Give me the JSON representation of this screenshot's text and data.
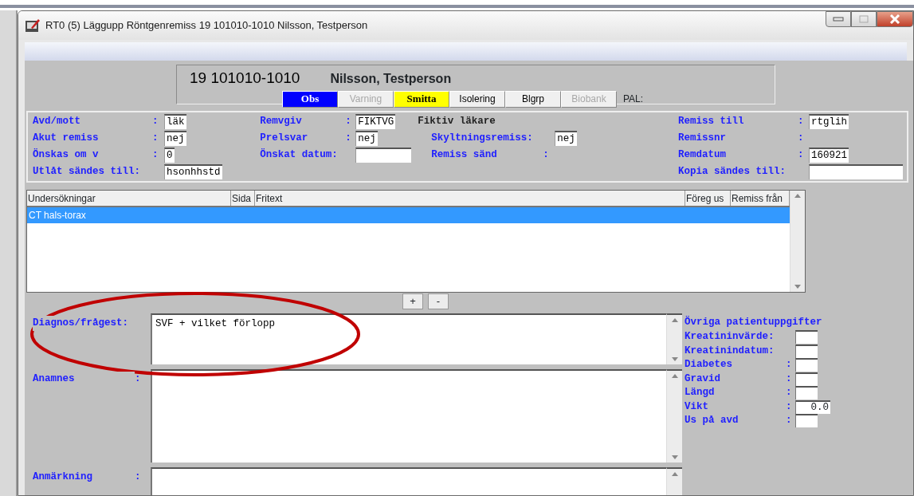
{
  "window": {
    "title": "RT0 (5) Läggupp Röntgenremiss 19 101010-1010 Nilsson, Testperson"
  },
  "patient": {
    "id": "19 101010-1010",
    "name": "Nilsson, Testperson",
    "pal_label": "PAL:",
    "flags": [
      {
        "label": "Obs",
        "color": "#0000ff",
        "emphasized": true,
        "disabled": false
      },
      {
        "label": "Varning",
        "color": "#f0f0f0",
        "emphasized": false,
        "disabled": true
      },
      {
        "label": "Smitta",
        "color": "#ffff00",
        "emphasized": true,
        "disabled": false
      },
      {
        "label": "Isolering",
        "color": "#f0f0f0",
        "emphasized": false,
        "disabled": false
      },
      {
        "label": "Blgrp",
        "color": "#f0f0f0",
        "emphasized": false,
        "disabled": false
      },
      {
        "label": "Biobank",
        "color": "#f0f0f0",
        "emphasized": false,
        "disabled": true
      }
    ]
  },
  "form": {
    "columns": [
      {
        "fields": [
          {
            "kind": "input",
            "label": "Avd/mott",
            "colon": ":",
            "value": "läk"
          },
          {
            "kind": "input",
            "label": "Akut remiss",
            "colon": ":",
            "value": "nej"
          },
          {
            "kind": "input",
            "label": "Önskas om v",
            "colon": ":",
            "value": "0"
          },
          {
            "kind": "input",
            "label": "Utlåt sändes till:",
            "value": "hsonhhstd"
          }
        ]
      },
      {
        "fields": [
          {
            "kind": "input",
            "label": "Remvgiv",
            "colon": ":",
            "value": "FIKTVG"
          },
          {
            "kind": "input",
            "label": "Prelsvar",
            "colon": ":",
            "value": "nej"
          },
          {
            "kind": "input",
            "label": "Önskat datum:"
          }
        ]
      },
      {
        "fields": [
          {
            "kind": "note",
            "label": "Fiktiv läkare"
          },
          {
            "kind": "input",
            "label": "Skyltningsremiss:",
            "value": "nej"
          },
          {
            "kind": "label",
            "label": "Remiss sänd",
            "colon": ":"
          }
        ]
      },
      {
        "fields": [
          {
            "kind": "input",
            "label": "Remiss till",
            "colon": ":",
            "value": "rtglih"
          },
          {
            "kind": "label",
            "label": "Remissnr",
            "colon": ":"
          },
          {
            "kind": "input",
            "label": "Remdatum",
            "colon": ":",
            "value": "160921"
          },
          {
            "kind": "input",
            "label": "Kopia sändes till:"
          }
        ]
      }
    ]
  },
  "examinations": {
    "columns": [
      "Undersökningar",
      "Sida",
      "Fritext",
      "Föreg us",
      "Remiss från"
    ],
    "rows": [
      {
        "text": "CT hals-torax",
        "selected": true
      }
    ],
    "buttons": [
      "+",
      "-"
    ]
  },
  "notes": [
    {
      "label": "Diagnos/frågest:",
      "value": "SVF + vilket förlopp"
    },
    {
      "label": "Anamnes",
      "colon": ":"
    },
    {
      "label": "Anmärkning",
      "colon": ":"
    }
  ],
  "other_patient_info": {
    "title": "Övriga patientuppgifter",
    "fields": [
      {
        "label": "Kreatininvärde:"
      },
      {
        "label": "Kreatinindatum:"
      },
      {
        "label": "Diabetes",
        "colon": ":"
      },
      {
        "label": "Gravid",
        "colon": ":"
      },
      {
        "label": "Längd",
        "colon": ":"
      },
      {
        "label": "Vikt",
        "colon": ":",
        "value": "0.0"
      },
      {
        "label": "Us på avd",
        "colon": ":"
      }
    ]
  },
  "annotation": {
    "kind": "ellipse"
  }
}
